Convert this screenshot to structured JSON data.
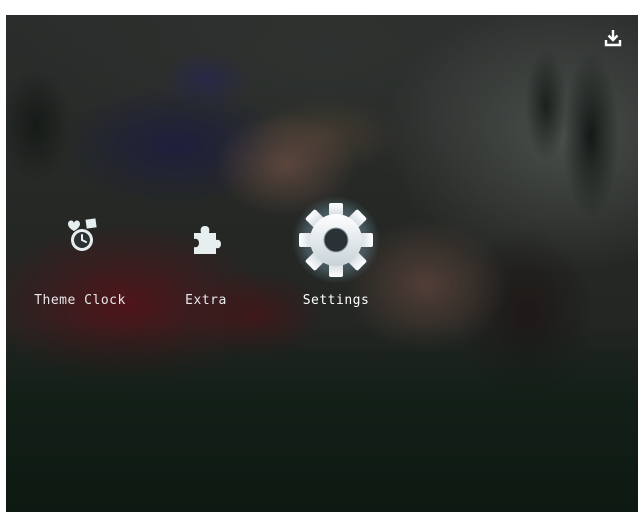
{
  "screen": {
    "accent_color": "#c8ecff",
    "header": {
      "export_icon": "download-to-tray-icon"
    },
    "menu": {
      "items": [
        {
          "label": "Theme Clock",
          "icon": "theme-clock-icon",
          "selected": false
        },
        {
          "label": "Extra",
          "icon": "puzzle-piece-icon",
          "selected": false
        },
        {
          "label": "Settings",
          "icon": "gear-icon",
          "selected": true
        }
      ]
    }
  }
}
